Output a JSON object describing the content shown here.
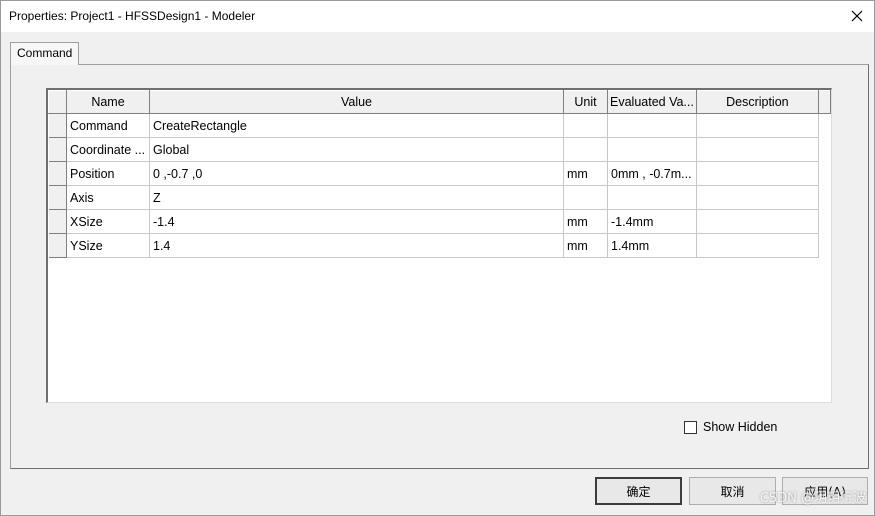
{
  "window": {
    "title": "Properties: Project1 - HFSSDesign1 - Modeler"
  },
  "tabs": [
    {
      "label": "Command"
    }
  ],
  "table": {
    "headers": {
      "name": "Name",
      "value": "Value",
      "unit": "Unit",
      "evaluated": "Evaluated Va...",
      "description": "Description"
    },
    "rows": [
      {
        "name": "Command",
        "value": "CreateRectangle",
        "unit": "",
        "evaluated": "",
        "description": ""
      },
      {
        "name": "Coordinate ...",
        "value": "Global",
        "unit": "",
        "evaluated": "",
        "description": ""
      },
      {
        "name": "Position",
        "value": "0 ,-0.7 ,0",
        "unit": "mm",
        "evaluated": "0mm , -0.7m...",
        "description": ""
      },
      {
        "name": "Axis",
        "value": "Z",
        "unit": "",
        "evaluated": "",
        "description": ""
      },
      {
        "name": "XSize",
        "value": "-1.4",
        "unit": "mm",
        "evaluated": "-1.4mm",
        "description": ""
      },
      {
        "name": "YSize",
        "value": "1.4",
        "unit": "mm",
        "evaluated": "1.4mm",
        "description": ""
      }
    ]
  },
  "show_hidden": {
    "label": "Show Hidden",
    "checked": false
  },
  "buttons": {
    "ok": "确定",
    "cancel": "取消",
    "apply": "应用(A)"
  },
  "watermark": "CSDN @玥玥行波",
  "icons": {
    "close": "close-icon"
  }
}
